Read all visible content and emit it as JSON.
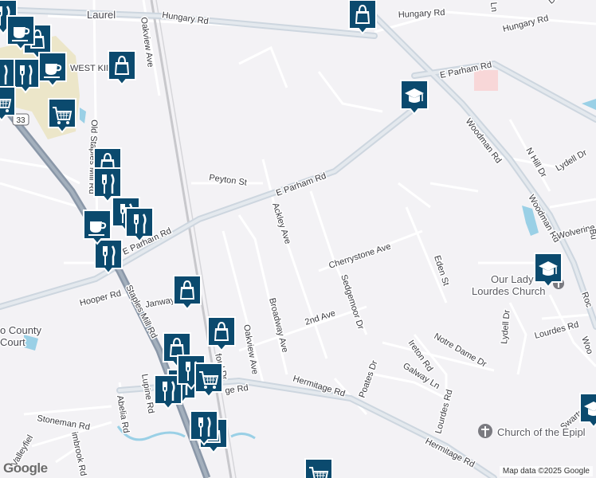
{
  "labels": {
    "laurel": "Laurel",
    "west_kingsville": "WEST KINGSVI",
    "county_court": "o County",
    "county_court2": "Court",
    "hungary_rd_w": "Hungary Rd",
    "hungary_rd_e": "Hungary Rd",
    "hungary_rd_far": "Hungary Rd",
    "e_parham_rd_ne": "E Parham Rd",
    "e_parham_rd_mid": "E Parham Rd",
    "e_parham_rd_sw": "E Parham Rd",
    "oakview_ave_n": "Oakview Ave",
    "oakview_ave_s": "Oakview Ave",
    "old_staples_mill": "Old Staples Mill Rd",
    "peyton_st": "Peyton St",
    "ackley_ave": "Ackley Ave",
    "cherrystone_ave": "Cherrystone Ave",
    "sedgemoor_dr": "Sedgemoor Dr",
    "eden_st": "Eden St",
    "second_ave": "2nd Ave",
    "broadway_ave": "Broadway Ave",
    "hooper_rd": "Hooper Rd",
    "janway": "Janway",
    "staples_mill_rd": "Staples Mill Rd",
    "woodman_rd_n": "Woodman Rd",
    "woodman_rd_s": "Woodman Rd",
    "n_hill_dr": "N Hill Dr",
    "lydell_dr_n": "Lydell Dr",
    "lydell_dr_s": "Lydell Dr",
    "wolverine": "Wolverine",
    "hermitage_rd_w": "Hermitage Rd",
    "hermitage_rd_e": "Hermitage Rd",
    "poates_dr": "Poates Dr",
    "ireton_rd": "Ireton Rd",
    "notre_dame_dr": "Notre Dame Dr",
    "galway_ln": "Galway Ln",
    "lourdes_rd_s": "Lourdes Rd",
    "lourdes_rd_e": "Lourdes Rd",
    "lupine_rd": "Lupine Rd",
    "abelia_rd": "Abelia Rd",
    "stoneman_rd": "Stoneman Rd",
    "valleyfield": "Valleyfiel",
    "timbrook": "imbrook Rd",
    "swartout": "Swartout A",
    "ford_dr": "ford Dr",
    "ge_rd": "ge Rd",
    "our_lady_1": "Our Lady",
    "our_lady_2": "Lourdes Church",
    "church_epiphany": "Church of the Epipl",
    "route_33": "33",
    "woo_edge": "Woo",
    "roc_edge": "Roc",
    "bu_edge": "Bu",
    "ln_edge": "Ln",
    "dr_edge": "Dr"
  },
  "icons": {
    "shopping": "shopping-bag-icon",
    "restaurant": "fork-knife-icon",
    "cafe": "coffee-cup-icon",
    "grocery": "shopping-cart-icon",
    "school": "graduation-cap-icon",
    "church": "cross-icon"
  },
  "colors": {
    "pin_fill": "#0b4a6e",
    "pin_stroke": "#ffffff",
    "road_major": "#c9d3dc",
    "road_minor": "#ffffff",
    "rail": "#c8c8cc",
    "park": "#e8e4c4",
    "water": "#9ad0e6",
    "highway": "#8a97a8",
    "building": "#f8d7d8"
  },
  "footer": {
    "google": "Google",
    "map_data": "Map data ©2025 Google"
  }
}
